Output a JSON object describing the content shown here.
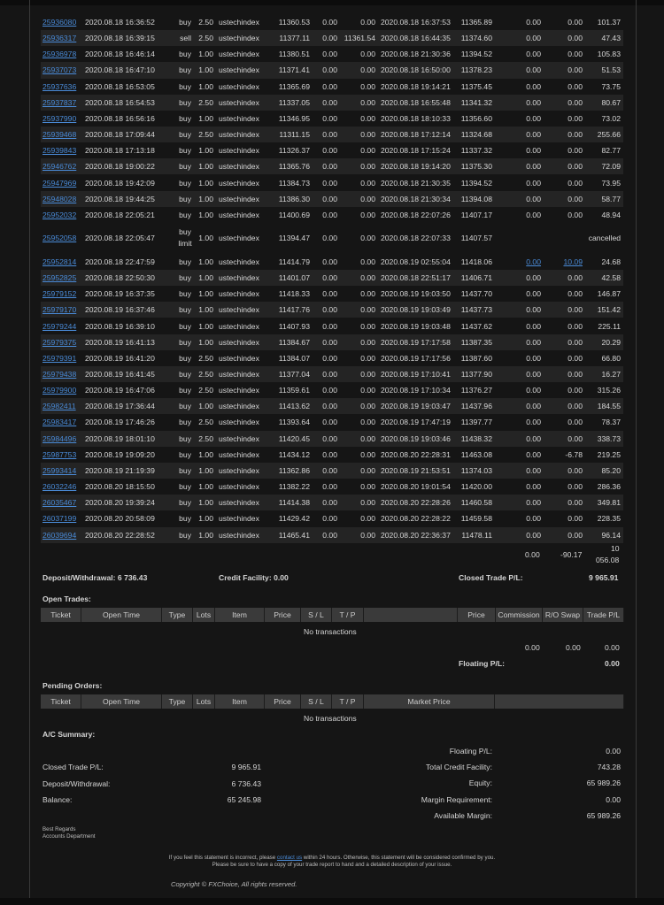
{
  "closed_trades": [
    {
      "ticket": "25936080",
      "open_time": "2020.08.18 16:36:52",
      "type": "buy",
      "lots": "2.50",
      "item": "ustechindex",
      "price": "11360.53",
      "sl": "0.00",
      "tp": "0.00",
      "close_time": "2020.08.18 16:37:53",
      "close_price": "11365.89",
      "commission": "0.00",
      "swap": "0.00",
      "pl": "101.37"
    },
    {
      "ticket": "25936317",
      "open_time": "2020.08.18 16:39:15",
      "type": "sell",
      "lots": "2.50",
      "item": "ustechindex",
      "price": "11377.11",
      "sl": "0.00",
      "tp": "11361.54",
      "close_time": "2020.08.18 16:44:35",
      "close_price": "11374.60",
      "commission": "0.00",
      "swap": "0.00",
      "pl": "47.43"
    },
    {
      "ticket": "25936978",
      "open_time": "2020.08.18 16:46:14",
      "type": "buy",
      "lots": "1.00",
      "item": "ustechindex",
      "price": "11380.51",
      "sl": "0.00",
      "tp": "0.00",
      "close_time": "2020.08.18 21:30:36",
      "close_price": "11394.52",
      "commission": "0.00",
      "swap": "0.00",
      "pl": "105.83"
    },
    {
      "ticket": "25937073",
      "open_time": "2020.08.18 16:47:10",
      "type": "buy",
      "lots": "1.00",
      "item": "ustechindex",
      "price": "11371.41",
      "sl": "0.00",
      "tp": "0.00",
      "close_time": "2020.08.18 16:50:00",
      "close_price": "11378.23",
      "commission": "0.00",
      "swap": "0.00",
      "pl": "51.53"
    },
    {
      "ticket": "25937636",
      "open_time": "2020.08.18 16:53:05",
      "type": "buy",
      "lots": "1.00",
      "item": "ustechindex",
      "price": "11365.69",
      "sl": "0.00",
      "tp": "0.00",
      "close_time": "2020.08.18 19:14:21",
      "close_price": "11375.45",
      "commission": "0.00",
      "swap": "0.00",
      "pl": "73.75"
    },
    {
      "ticket": "25937837",
      "open_time": "2020.08.18 16:54:53",
      "type": "buy",
      "lots": "2.50",
      "item": "ustechindex",
      "price": "11337.05",
      "sl": "0.00",
      "tp": "0.00",
      "close_time": "2020.08.18 16:55:48",
      "close_price": "11341.32",
      "commission": "0.00",
      "swap": "0.00",
      "pl": "80.67"
    },
    {
      "ticket": "25937990",
      "open_time": "2020.08.18 16:56:16",
      "type": "buy",
      "lots": "1.00",
      "item": "ustechindex",
      "price": "11346.95",
      "sl": "0.00",
      "tp": "0.00",
      "close_time": "2020.08.18 18:10:33",
      "close_price": "11356.60",
      "commission": "0.00",
      "swap": "0.00",
      "pl": "73.02"
    },
    {
      "ticket": "25939468",
      "open_time": "2020.08.18 17:09:44",
      "type": "buy",
      "lots": "2.50",
      "item": "ustechindex",
      "price": "11311.15",
      "sl": "0.00",
      "tp": "0.00",
      "close_time": "2020.08.18 17:12:14",
      "close_price": "11324.68",
      "commission": "0.00",
      "swap": "0.00",
      "pl": "255.66"
    },
    {
      "ticket": "25939843",
      "open_time": "2020.08.18 17:13:18",
      "type": "buy",
      "lots": "1.00",
      "item": "ustechindex",
      "price": "11326.37",
      "sl": "0.00",
      "tp": "0.00",
      "close_time": "2020.08.18 17:15:24",
      "close_price": "11337.32",
      "commission": "0.00",
      "swap": "0.00",
      "pl": "82.77"
    },
    {
      "ticket": "25946762",
      "open_time": "2020.08.18 19:00:22",
      "type": "buy",
      "lots": "1.00",
      "item": "ustechindex",
      "price": "11365.76",
      "sl": "0.00",
      "tp": "0.00",
      "close_time": "2020.08.18 19:14:20",
      "close_price": "11375.30",
      "commission": "0.00",
      "swap": "0.00",
      "pl": "72.09"
    },
    {
      "ticket": "25947969",
      "open_time": "2020.08.18 19:42:09",
      "type": "buy",
      "lots": "1.00",
      "item": "ustechindex",
      "price": "11384.73",
      "sl": "0.00",
      "tp": "0.00",
      "close_time": "2020.08.18 21:30:35",
      "close_price": "11394.52",
      "commission": "0.00",
      "swap": "0.00",
      "pl": "73.95"
    },
    {
      "ticket": "25948028",
      "open_time": "2020.08.18 19:44:25",
      "type": "buy",
      "lots": "1.00",
      "item": "ustechindex",
      "price": "11386.30",
      "sl": "0.00",
      "tp": "0.00",
      "close_time": "2020.08.18 21:30:34",
      "close_price": "11394.08",
      "commission": "0.00",
      "swap": "0.00",
      "pl": "58.77"
    },
    {
      "ticket": "25952032",
      "open_time": "2020.08.18 22:05:21",
      "type": "buy",
      "lots": "1.00",
      "item": "ustechindex",
      "price": "11400.69",
      "sl": "0.00",
      "tp": "0.00",
      "close_time": "2020.08.18 22:07:26",
      "close_price": "11407.17",
      "commission": "0.00",
      "swap": "0.00",
      "pl": "48.94"
    }
  ],
  "cancelled_order": {
    "ticket": "25952058",
    "open_time": "2020.08.18 22:05:47",
    "type_line1": "buy",
    "type_line2": "limit",
    "lots": "1.00",
    "item": "ustechindex",
    "price": "11394.47",
    "sl": "0.00",
    "tp": "0.00",
    "close_time": "2020.08.18 22:07:33",
    "close_price": "11407.57",
    "status": "cancelled"
  },
  "linked_row": {
    "ticket": "25952814",
    "open_time": "2020.08.18 22:47:59",
    "type": "buy",
    "lots": "1.00",
    "item": "ustechindex",
    "price": "11414.79",
    "sl": "0.00",
    "tp": "0.00",
    "close_time": "2020.08.19 02:55:04",
    "close_price": "11418.06",
    "commission": "0.00",
    "swap": "10.09",
    "pl": "24.68"
  },
  "closed_trades_2": [
    {
      "ticket": "25952825",
      "open_time": "2020.08.18 22:50:30",
      "type": "buy",
      "lots": "1.00",
      "item": "ustechindex",
      "price": "11401.07",
      "sl": "0.00",
      "tp": "0.00",
      "close_time": "2020.08.18 22:51:17",
      "close_price": "11406.71",
      "commission": "0.00",
      "swap": "0.00",
      "pl": "42.58"
    },
    {
      "ticket": "25979152",
      "open_time": "2020.08.19 16:37:35",
      "type": "buy",
      "lots": "1.00",
      "item": "ustechindex",
      "price": "11418.33",
      "sl": "0.00",
      "tp": "0.00",
      "close_time": "2020.08.19 19:03:50",
      "close_price": "11437.70",
      "commission": "0.00",
      "swap": "0.00",
      "pl": "146.87"
    },
    {
      "ticket": "25979170",
      "open_time": "2020.08.19 16:37:46",
      "type": "buy",
      "lots": "1.00",
      "item": "ustechindex",
      "price": "11417.76",
      "sl": "0.00",
      "tp": "0.00",
      "close_time": "2020.08.19 19:03:49",
      "close_price": "11437.73",
      "commission": "0.00",
      "swap": "0.00",
      "pl": "151.42"
    },
    {
      "ticket": "25979244",
      "open_time": "2020.08.19 16:39:10",
      "type": "buy",
      "lots": "1.00",
      "item": "ustechindex",
      "price": "11407.93",
      "sl": "0.00",
      "tp": "0.00",
      "close_time": "2020.08.19 19:03:48",
      "close_price": "11437.62",
      "commission": "0.00",
      "swap": "0.00",
      "pl": "225.11"
    },
    {
      "ticket": "25979375",
      "open_time": "2020.08.19 16:41:13",
      "type": "buy",
      "lots": "1.00",
      "item": "ustechindex",
      "price": "11384.67",
      "sl": "0.00",
      "tp": "0.00",
      "close_time": "2020.08.19 17:17:58",
      "close_price": "11387.35",
      "commission": "0.00",
      "swap": "0.00",
      "pl": "20.29"
    },
    {
      "ticket": "25979391",
      "open_time": "2020.08.19 16:41:20",
      "type": "buy",
      "lots": "2.50",
      "item": "ustechindex",
      "price": "11384.07",
      "sl": "0.00",
      "tp": "0.00",
      "close_time": "2020.08.19 17:17:56",
      "close_price": "11387.60",
      "commission": "0.00",
      "swap": "0.00",
      "pl": "66.80"
    },
    {
      "ticket": "25979438",
      "open_time": "2020.08.19 16:41:45",
      "type": "buy",
      "lots": "2.50",
      "item": "ustechindex",
      "price": "11377.04",
      "sl": "0.00",
      "tp": "0.00",
      "close_time": "2020.08.19 17:10:41",
      "close_price": "11377.90",
      "commission": "0.00",
      "swap": "0.00",
      "pl": "16.27"
    },
    {
      "ticket": "25979900",
      "open_time": "2020.08.19 16:47:06",
      "type": "buy",
      "lots": "2.50",
      "item": "ustechindex",
      "price": "11359.61",
      "sl": "0.00",
      "tp": "0.00",
      "close_time": "2020.08.19 17:10:34",
      "close_price": "11376.27",
      "commission": "0.00",
      "swap": "0.00",
      "pl": "315.26"
    },
    {
      "ticket": "25982411",
      "open_time": "2020.08.19 17:36:44",
      "type": "buy",
      "lots": "1.00",
      "item": "ustechindex",
      "price": "11413.62",
      "sl": "0.00",
      "tp": "0.00",
      "close_time": "2020.08.19 19:03:47",
      "close_price": "11437.96",
      "commission": "0.00",
      "swap": "0.00",
      "pl": "184.55"
    },
    {
      "ticket": "25983417",
      "open_time": "2020.08.19 17:46:26",
      "type": "buy",
      "lots": "2.50",
      "item": "ustechindex",
      "price": "11393.64",
      "sl": "0.00",
      "tp": "0.00",
      "close_time": "2020.08.19 17:47:19",
      "close_price": "11397.77",
      "commission": "0.00",
      "swap": "0.00",
      "pl": "78.37"
    },
    {
      "ticket": "25984496",
      "open_time": "2020.08.19 18:01:10",
      "type": "buy",
      "lots": "2.50",
      "item": "ustechindex",
      "price": "11420.45",
      "sl": "0.00",
      "tp": "0.00",
      "close_time": "2020.08.19 19:03:46",
      "close_price": "11438.32",
      "commission": "0.00",
      "swap": "0.00",
      "pl": "338.73"
    },
    {
      "ticket": "25987753",
      "open_time": "2020.08.19 19:09:20",
      "type": "buy",
      "lots": "1.00",
      "item": "ustechindex",
      "price": "11434.12",
      "sl": "0.00",
      "tp": "0.00",
      "close_time": "2020.08.20 22:28:31",
      "close_price": "11463.08",
      "commission": "0.00",
      "swap": "-6.78",
      "pl": "219.25"
    },
    {
      "ticket": "25993414",
      "open_time": "2020.08.19 21:19:39",
      "type": "buy",
      "lots": "1.00",
      "item": "ustechindex",
      "price": "11362.86",
      "sl": "0.00",
      "tp": "0.00",
      "close_time": "2020.08.19 21:53:51",
      "close_price": "11374.03",
      "commission": "0.00",
      "swap": "0.00",
      "pl": "85.20"
    },
    {
      "ticket": "26032246",
      "open_time": "2020.08.20 18:15:50",
      "type": "buy",
      "lots": "1.00",
      "item": "ustechindex",
      "price": "11382.22",
      "sl": "0.00",
      "tp": "0.00",
      "close_time": "2020.08.20 19:01:54",
      "close_price": "11420.00",
      "commission": "0.00",
      "swap": "0.00",
      "pl": "286.36"
    },
    {
      "ticket": "26035467",
      "open_time": "2020.08.20 19:39:24",
      "type": "buy",
      "lots": "1.00",
      "item": "ustechindex",
      "price": "11414.38",
      "sl": "0.00",
      "tp": "0.00",
      "close_time": "2020.08.20 22:28:26",
      "close_price": "11460.58",
      "commission": "0.00",
      "swap": "0.00",
      "pl": "349.81"
    },
    {
      "ticket": "26037199",
      "open_time": "2020.08.20 20:58:09",
      "type": "buy",
      "lots": "1.00",
      "item": "ustechindex",
      "price": "11429.42",
      "sl": "0.00",
      "tp": "0.00",
      "close_time": "2020.08.20 22:28:22",
      "close_price": "11459.58",
      "commission": "0.00",
      "swap": "0.00",
      "pl": "228.35"
    },
    {
      "ticket": "26039694",
      "open_time": "2020.08.20 22:28:52",
      "type": "buy",
      "lots": "1.00",
      "item": "ustechindex",
      "price": "11465.41",
      "sl": "0.00",
      "tp": "0.00",
      "close_time": "2020.08.20 22:36:37",
      "close_price": "11478.11",
      "commission": "0.00",
      "swap": "0.00",
      "pl": "96.14"
    }
  ],
  "totals": {
    "commission": "0.00",
    "swap": "-90.17",
    "pl_line1": "10",
    "pl_line2": "056.08"
  },
  "summary_line": {
    "deposit_label": "Deposit/Withdrawal: 6 736.43",
    "credit_label": "Credit Facility: 0.00",
    "closed_pl_label": "Closed Trade P/L:",
    "closed_pl_value": "9 965.91"
  },
  "open_trades": {
    "title": "Open Trades:",
    "headers": [
      "Ticket",
      "Open Time",
      "Type",
      "Lots",
      "Item",
      "Price",
      "S / L",
      "T / P",
      "",
      "Price",
      "Commission",
      "R/O Swap",
      "Trade P/L"
    ],
    "empty": "No transactions",
    "commission": "0.00",
    "swap": "0.00",
    "pl": "0.00",
    "floating_label": "Floating P/L:",
    "floating_value": "0.00"
  },
  "pending_orders": {
    "title": "Pending Orders:",
    "headers": [
      "Ticket",
      "Open Time",
      "Type",
      "Lots",
      "Item",
      "Price",
      "S / L",
      "T / P",
      "Market Price",
      ""
    ],
    "empty": "No transactions"
  },
  "ac_summary": {
    "title": "A/C Summary:",
    "left": [
      {
        "label": "Closed Trade P/L:",
        "value": "9 965.91"
      },
      {
        "label": "Deposit/Withdrawal:",
        "value": "6 736.43"
      },
      {
        "label": "Balance:",
        "value": "65 245.98"
      }
    ],
    "right": [
      {
        "label": "Floating P/L:",
        "value": "0.00"
      },
      {
        "label": "Total Credit Facility:",
        "value": "743.28"
      },
      {
        "label": "Equity:",
        "value": "65 989.26"
      },
      {
        "label": "Margin Requirement:",
        "value": "0.00"
      },
      {
        "label": "Available Margin:",
        "value": "65 989.26"
      }
    ]
  },
  "footer": {
    "regards": "Best Regards",
    "department": "Accounts Department",
    "notice_pre": "If you feel this statement is incorrect, please ",
    "notice_link": "contact us",
    "notice_post": " within 24 hours. Otherwise, this statement will be considered confirmed by you.",
    "notice_line2": "Please be sure to have a copy of your trade report to hand and a detailed description of your issue.",
    "copyright": "Copyright © FXChoice, All rights reserved."
  },
  "colors": {
    "link": "#4a8bd8",
    "background": "#151515",
    "row_alt": "#242424",
    "header": "#3a3a3a"
  }
}
